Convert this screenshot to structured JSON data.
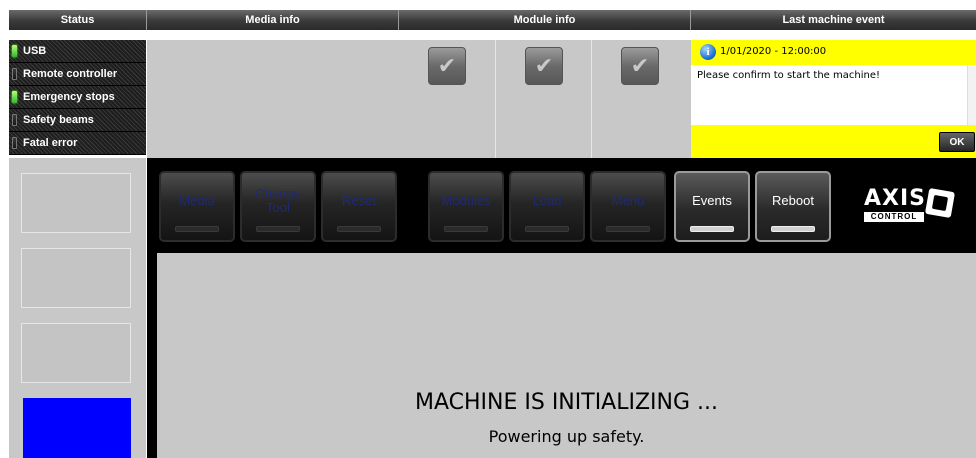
{
  "header": {
    "status": "Status",
    "media_info": "Media info",
    "module_info": "Module info",
    "last_event": "Last machine event"
  },
  "status_items": [
    {
      "label": "USB",
      "state": "on"
    },
    {
      "label": "Remote controller",
      "state": "off"
    },
    {
      "label": "Emergency stops",
      "state": "on"
    },
    {
      "label": "Safety beams",
      "state": "off"
    },
    {
      "label": "Fatal error",
      "state": "off"
    }
  ],
  "modules": [
    "module-1",
    "module-2",
    "module-3"
  ],
  "event": {
    "timestamp": "1/01/2020 - 12:00:00",
    "message": "Please confirm to start the machine!",
    "ok_label": "OK",
    "highlight_color": "#ffff00"
  },
  "toolbar": {
    "media": "Media",
    "change_tool": "Change Tool",
    "reset": "Reset",
    "modules": "Modules",
    "load": "Load",
    "menu": "Menu",
    "events": "Events",
    "reboot": "Reboot"
  },
  "logo": {
    "name": "AXIS",
    "sub": "CONTROL"
  },
  "main": {
    "title": "MACHINE IS INITIALIZING ...",
    "subtitle": "Powering up safety."
  },
  "colors": {
    "led_on": "#2eb82e",
    "disabled_text": "#1f2a75",
    "sidebar_active": "#0000ff"
  }
}
